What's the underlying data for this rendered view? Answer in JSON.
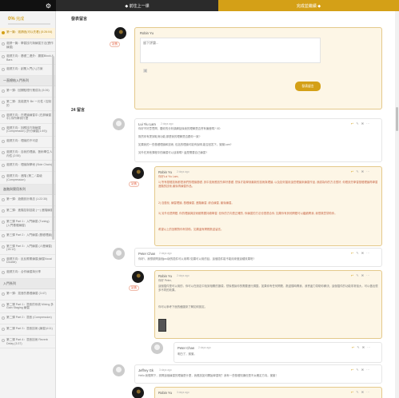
{
  "topbar": {
    "left_icon": "gear-icon",
    "prev_label": "◆ 前往上一课",
    "next_label": "完成並繼續 ◆"
  },
  "sidebar": {
    "progress_label": "完成",
    "progress_value": "0%",
    "progress_fraction": 0.0,
    "items": [
      {
        "label": "第一篇：邀請函(可以先看) (5:26:04)",
        "active": true
      },
      {
        "label": "邀請一篇：學習技巧與練習方法(實作練習)",
        "active": false
      },
      {
        "label": "邀請方向：基礎二連外：擴展Block & Bars",
        "active": false
      },
      {
        "label": "邀請方向：創業入門(八)方案",
        "active": false
      }
    ],
    "section1": "一直總結入門系列",
    "items2": [
      {
        "label": "第一課：回歸點理行業成功 (5:26)"
      },
      {
        "label": "第二課：技能提升 Be 一元性 / 控制的"
      },
      {
        "label": "邀請方向：在理論練習中 (在那練習中) 你所學到什麼"
      },
      {
        "label": "邀請方向：回應技巧與練習 (Compression) (外分練習(1:49))"
      },
      {
        "label": "邀請方向：理論的不可逆"
      },
      {
        "label": "邀請方向：自我的理論，藝術學生人內性 (2:55)"
      },
      {
        "label": "邀請方向：理論與學術 (Side Chain)"
      },
      {
        "label": "邀請方向：進階 (第二 / 高級 (Compression)"
      }
    ],
    "section2": "進階與實用系列",
    "items3": [
      {
        "label": "第一課：遊戲設計概念 (1:22:35)"
      },
      {
        "label": "第二課：進階控制技能 (一) 進階練習"
      },
      {
        "label": "第三課 Part 1：入門練習 (Tuning) (入門基礎練習)"
      },
      {
        "label": "第三課 Part 2：入門練習 (基礎理論)"
      },
      {
        "label": "第三課 Part 3：入門練習 (人聲練習) (15:12)"
      },
      {
        "label": "邀請方向：反反覆覆練習(練習Vocal Double)"
      },
      {
        "label": "邀請方向：合作練習與分享"
      }
    ],
    "section3": "入門系列",
    "items4": [
      {
        "label": "第一課：混音的基礎練習 (3:47)"
      },
      {
        "label": "第二課 Part 1：混音的系統 Mixing 多 Gain Staging 練習"
      },
      {
        "label": "第二課 Part 2：混音 (Compression)"
      },
      {
        "label": "第二課 Part 3：混音技術 (練習(4:11)"
      },
      {
        "label": "第二課 Part 4：混音技術 Reverb Delay (3:37)"
      }
    ]
  },
  "comments_title": "發表留言",
  "form": {
    "name": "Robin Yu",
    "placeholder": "留下評論...",
    "submit": "發表留言",
    "image_icon": "image-icon",
    "badge": "站長"
  },
  "count_label": "24 留言",
  "comments": [
    {
      "name": "Lui Yiu Lam",
      "date": "2 days ago",
      "text": "你好不好意思問，聽你的分析講解話後我的理解是否會有偏差嗎? XD",
      "text2": "既然你有提到取消功能,那麼我的理解是否跟你一致?",
      "text3": "如果我的一些基礎理論和技術, 包括的理論可能有說明,能否回答下。謝謝Lam?",
      "text4": "另外在其他課程中的練習可以這樣嗎? 還是需要自己練習?"
    },
    {
      "name": "Robin Yu",
      "date": "2 days ago",
      "badge": "站長",
      "greet": "你好Lui Yiu Lam,",
      "text": "1) 所有基礎技術都是我們的理論基礎, 其中技術應該先學好基礎, 然後才能學到最新的技術與理論, 以及如何運用這些理論來練習作品, 我認為你的方法很好, 你應該先學習基礎理論再學習進階的技術,最後再練習作品。",
      "text2": "2) 自動化, 練習理論, 基礎練習, 進階練習, 綜合練習, 最後練習。",
      "text3": "3) 另外也是問題, 你的理論與技術都需要持續學習, 但你的方向是正確的, 你練習的方法也很適合你, 如果你有其他問題可以繼續問我, 我很樂意幫助你。",
      "text4": "希望以上的回覆對你有幫助。如果還有問題歡迎留言。"
    },
    {
      "name": "Peter Chan",
      "date": "2 days ago",
      "text": "你好!，我想請問這個pro版的插件可以用嗎?如果可以用的話，這個插件能不能用來做這種效果呢?"
    },
    {
      "name": "Robin Yu",
      "date": "2 days ago",
      "badge": "站長",
      "greet": "你好 Peter,",
      "text": "這個插件是可以用的，你可以在設定中找到相關的選項，然後根據你的需要進行調整。如果你有任何問題，歡迎隨時問我，我會盡力幫助你解決。這個插件的功能非常強大，可以做出很多不同的效果。",
      "text2": "你可以參考下面的截圖來了解如何設定。"
    },
    {
      "name": "Peter Chan",
      "date": "2 days ago",
      "text": "明白了，謝謝。"
    },
    {
      "name": "Jeffrey Gk",
      "date": "3 days ago",
      "text": "Hello 我想問下，請問這個練習的理論是什麼，我應該如何開始學習呢？我有一些基礎知識但是不太確定方向。謝謝！"
    },
    {
      "name": "Robin Yu",
      "date": "3 days ago",
      "badge": "站長"
    }
  ]
}
